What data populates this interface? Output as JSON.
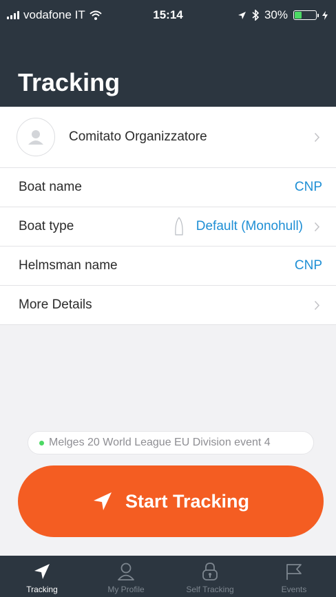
{
  "status_bar": {
    "carrier": "vodafone IT",
    "time": "15:14",
    "battery": "30%",
    "battery_level": 0.3,
    "battery_color": "#4cd964"
  },
  "header": {
    "title": "Tracking",
    "background": "#2c3640"
  },
  "profile": {
    "name": "Comitato Organizzatore",
    "icon": "avatar-icon"
  },
  "details": {
    "boat_name": {
      "label": "Boat name",
      "value": "CNP"
    },
    "boat_type": {
      "label": "Boat type",
      "value": "Default (Monohull)",
      "icon": "boat-icon"
    },
    "helmsman_name": {
      "label": "Helmsman name",
      "value": "CNP"
    },
    "more_details": {
      "label": "More Details"
    }
  },
  "event": {
    "name": "Melges 20 World League EU Division event 4",
    "status_color": "#4cd964"
  },
  "start_button": {
    "label": "Start Tracking",
    "icon": "navigation-arrow-icon",
    "color": "#f45d22"
  },
  "tabs": [
    {
      "label": "Tracking",
      "icon": "navigation-arrow-icon",
      "active": true
    },
    {
      "label": "My Profile",
      "icon": "person-icon",
      "active": false
    },
    {
      "label": "Self Tracking",
      "icon": "lock-icon",
      "active": false
    },
    {
      "label": "Events",
      "icon": "flag-icon",
      "active": false
    }
  ],
  "accent_color": "#1e8fd5"
}
